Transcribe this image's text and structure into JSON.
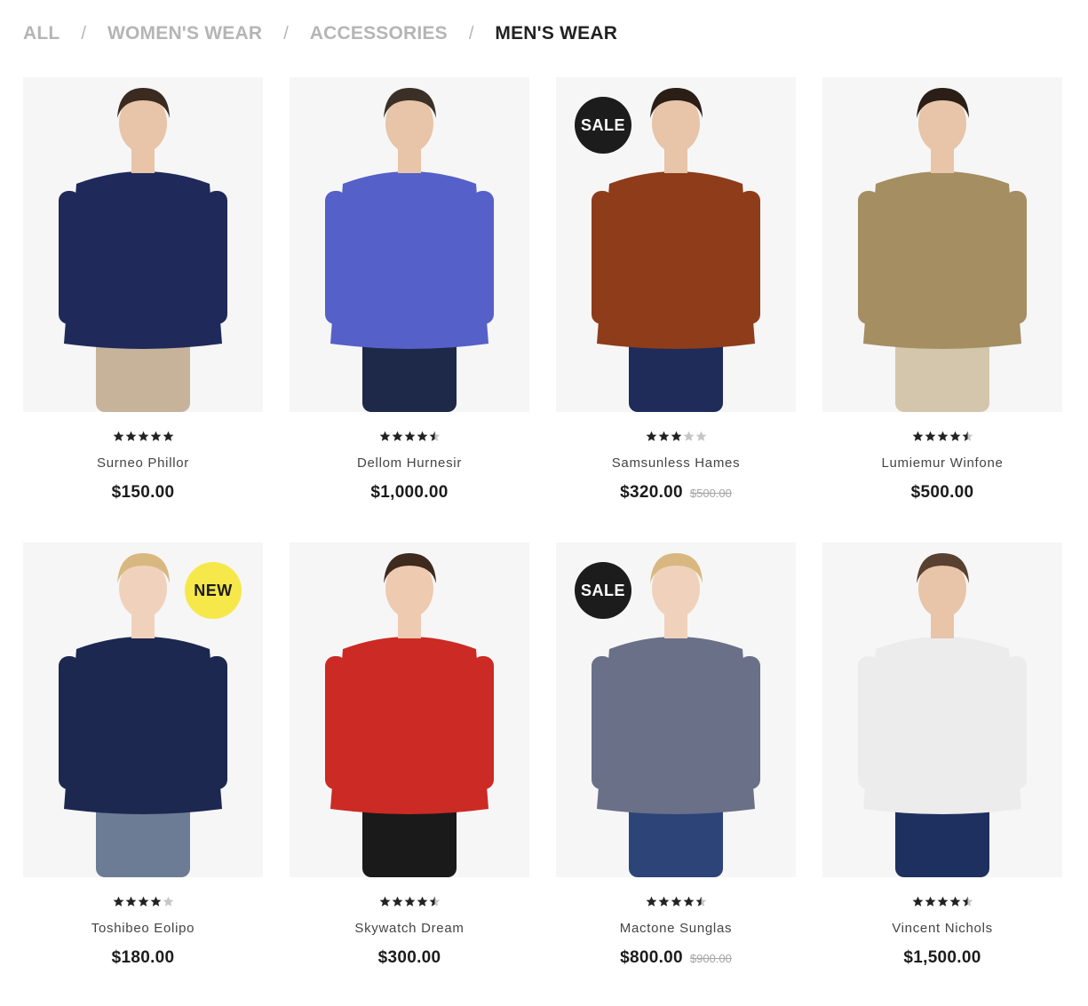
{
  "filters": [
    {
      "label": "ALL",
      "active": false
    },
    {
      "label": "WOMEN'S WEAR",
      "active": false
    },
    {
      "label": "ACCESSORIES",
      "active": false
    },
    {
      "label": "MEN'S WEAR",
      "active": true
    }
  ],
  "filter_separator": "/",
  "colors": {
    "filter_inactive": "#b5b5b5",
    "filter_active": "#222222",
    "star_filled": "#222222",
    "star_empty": "#c6c6c6",
    "sale_badge": "#1c1c1c",
    "new_badge": "#f6e84a"
  },
  "products": [
    {
      "name": "Surneo Phillor",
      "price": "$150.00",
      "old_price": "",
      "badge": "",
      "rating": 5,
      "figure": {
        "skin": "#e8c4a8",
        "hair": "#3a2a20",
        "top": "#1f2a5a",
        "bottom": "#c7b39a"
      }
    },
    {
      "name": "Dellom Hurnesir",
      "price": "$1,000.00",
      "old_price": "",
      "badge": "",
      "rating": 4.5,
      "figure": {
        "skin": "#e8c4a8",
        "hair": "#3a3028",
        "top": "#5560c8",
        "bottom": "#1e2848"
      }
    },
    {
      "name": "Samsunless Hames",
      "price": "$320.00",
      "old_price": "$500.00",
      "badge": "SALE",
      "rating": 3,
      "figure": {
        "skin": "#e8c4a8",
        "hair": "#2a1e16",
        "top": "#8e3c1a",
        "bottom": "#1f2c5a"
      }
    },
    {
      "name": "Lumiemur Winfone",
      "price": "$500.00",
      "old_price": "",
      "badge": "",
      "rating": 4.5,
      "figure": {
        "skin": "#e8c4a8",
        "hair": "#2a1e16",
        "top": "#a48e62",
        "bottom": "#d4c6ac"
      }
    },
    {
      "name": "Toshibeo Eolipo",
      "price": "$180.00",
      "old_price": "",
      "badge": "NEW",
      "rating": 4,
      "figure": {
        "skin": "#f0d2bc",
        "hair": "#d8b880",
        "top": "#1c2850",
        "bottom": "#6c7c94"
      }
    },
    {
      "name": "Skywatch Dream",
      "price": "$300.00",
      "old_price": "",
      "badge": "",
      "rating": 4.5,
      "figure": {
        "skin": "#eecab0",
        "hair": "#3e2a1e",
        "top": "#cc2a24",
        "bottom": "#1a1a1a"
      }
    },
    {
      "name": "Mactone Sunglas",
      "price": "$800.00",
      "old_price": "$900.00",
      "badge": "SALE",
      "rating": 4.5,
      "figure": {
        "skin": "#f0d2bc",
        "hair": "#d8b880",
        "top": "#6a7088",
        "bottom": "#2c4478"
      }
    },
    {
      "name": "Vincent Nichols",
      "price": "$1,500.00",
      "old_price": "",
      "badge": "",
      "rating": 4.5,
      "figure": {
        "skin": "#e8c4a8",
        "hair": "#5a4030",
        "top": "#ececec",
        "bottom": "#1e3060"
      }
    }
  ]
}
